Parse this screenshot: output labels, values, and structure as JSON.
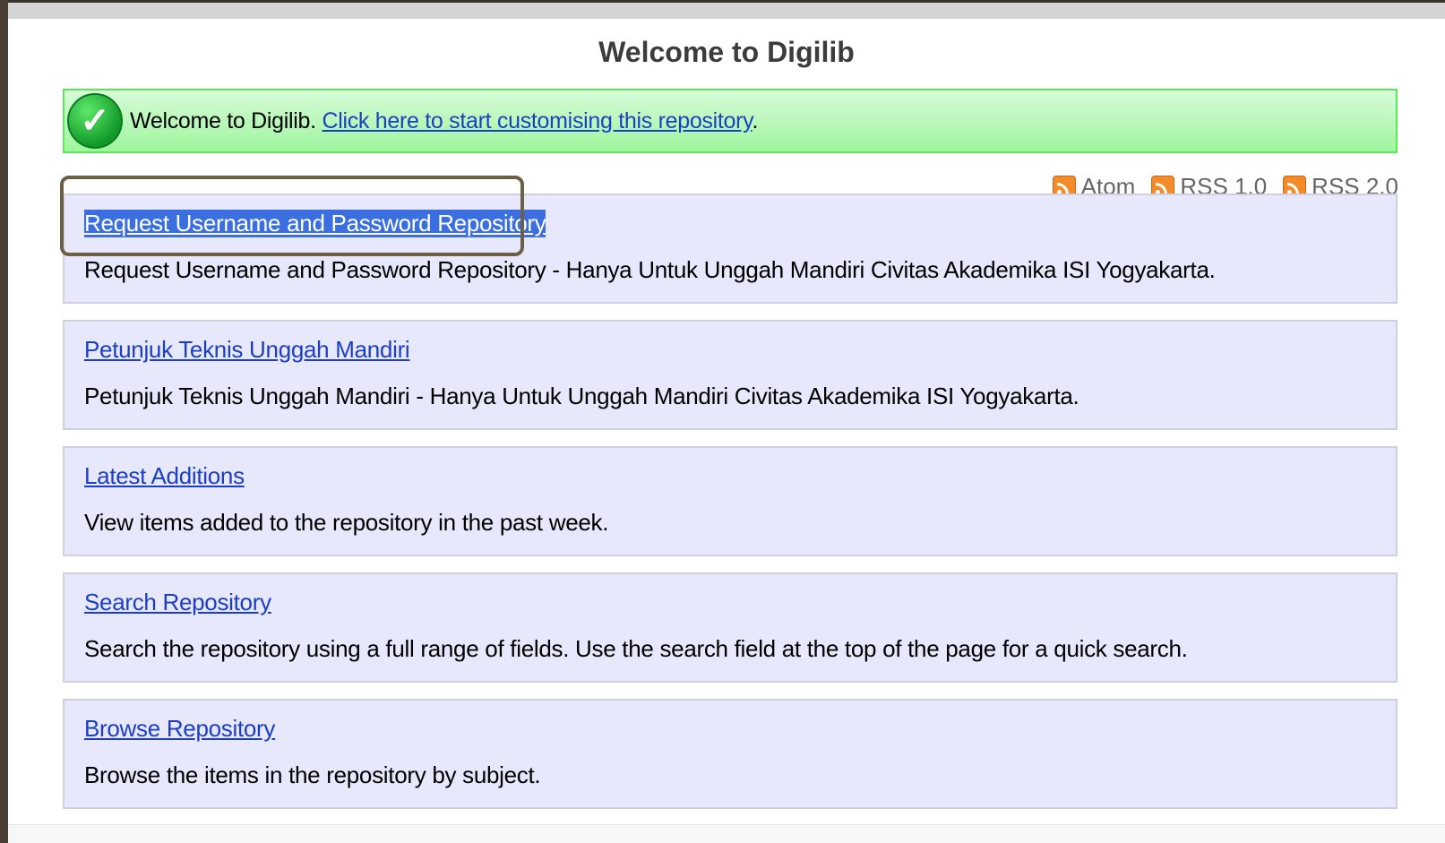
{
  "header": {
    "title": "Welcome to Digilib"
  },
  "message": {
    "text": "Welcome to Digilib. ",
    "link": "Click here to start customising this repository",
    "suffix": "."
  },
  "feeds": [
    "Atom",
    "RSS 1.0",
    "RSS 2.0"
  ],
  "cards": [
    {
      "title": "Request Username and Password Repository",
      "description": "Request Username and Password Repository - Hanya Untuk Unggah Mandiri Civitas Akademika ISI Yogyakarta."
    },
    {
      "title": "Petunjuk Teknis Unggah Mandiri",
      "description": "Petunjuk Teknis Unggah Mandiri - Hanya Untuk Unggah Mandiri Civitas Akademika ISI Yogyakarta."
    },
    {
      "title": "Latest Additions",
      "description": "View items added to the repository in the past week."
    },
    {
      "title": "Search Repository",
      "description": "Search the repository using a full range of fields. Use the search field at the top of the page for a quick search."
    },
    {
      "title": "Browse Repository",
      "description": "Browse the items in the repository by subject."
    }
  ],
  "colors": {
    "link": "#1b3ec5",
    "card_bg": "#e7e8fb",
    "message_border": "#5ae85a",
    "highlight_border": "#6b5f45"
  }
}
